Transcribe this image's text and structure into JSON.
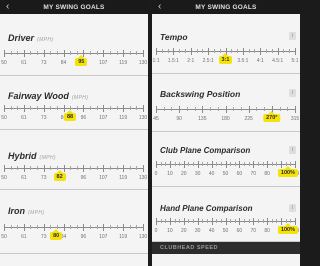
{
  "left": {
    "title": "MY SWING GOALS",
    "goals": [
      {
        "name": "Driver",
        "unit": "(MPH)",
        "ticks": [
          "50",
          "61",
          "73",
          "84",
          "96",
          "107",
          "119",
          "130"
        ],
        "value": "95",
        "value_fraction": 0.556
      },
      {
        "name": "Fairway Wood",
        "unit": "(MPH)",
        "ticks": [
          "50",
          "61",
          "73",
          "84",
          "96",
          "107",
          "119",
          "130"
        ],
        "value": "88",
        "value_fraction": 0.475
      },
      {
        "name": "Hybrid",
        "unit": "(MPH)",
        "ticks": [
          "50",
          "61",
          "73",
          "84",
          "96",
          "107",
          "119",
          "130"
        ],
        "value": "82",
        "value_fraction": 0.4
      },
      {
        "name": "Iron",
        "unit": "(MPH)",
        "ticks": [
          "50",
          "61",
          "73",
          "84",
          "96",
          "107",
          "119",
          "130"
        ],
        "value": "80",
        "value_fraction": 0.375
      }
    ]
  },
  "right": {
    "title": "MY SWING GOALS",
    "goals": [
      {
        "name": "Tempo",
        "ticks": [
          "1:1",
          "1.5:1",
          "2:1",
          "2.5:1",
          "3:1",
          "3.5:1",
          "4:1",
          "4.5:1",
          "5:1"
        ],
        "value": "3:1",
        "value_fraction": 0.5
      },
      {
        "name": "Backswing Position",
        "ticks": [
          "45",
          "90",
          "135",
          "180",
          "225",
          "270",
          "315"
        ],
        "value": "270°",
        "value_fraction": 0.833
      },
      {
        "name": "Club Plane Comparison",
        "ticks": [
          "0",
          "10",
          "20",
          "30",
          "40",
          "50",
          "60",
          "70",
          "80",
          "90",
          "100"
        ],
        "value": "100%",
        "value_fraction": 1.0
      },
      {
        "name": "Hand Plane Comparison",
        "ticks": [
          "0",
          "10",
          "20",
          "30",
          "40",
          "50",
          "60",
          "70",
          "80",
          "90",
          "100"
        ],
        "value": "100%",
        "value_fraction": 1.0
      }
    ],
    "section_header": "CLUBHEAD SPEED"
  },
  "icons": {
    "back": "back-arrow-icon",
    "info": "info-icon"
  },
  "colors": {
    "accent": "#f4e20a",
    "nav_bg": "#1a1a1a",
    "panel_bg": "#f4f4f4"
  }
}
